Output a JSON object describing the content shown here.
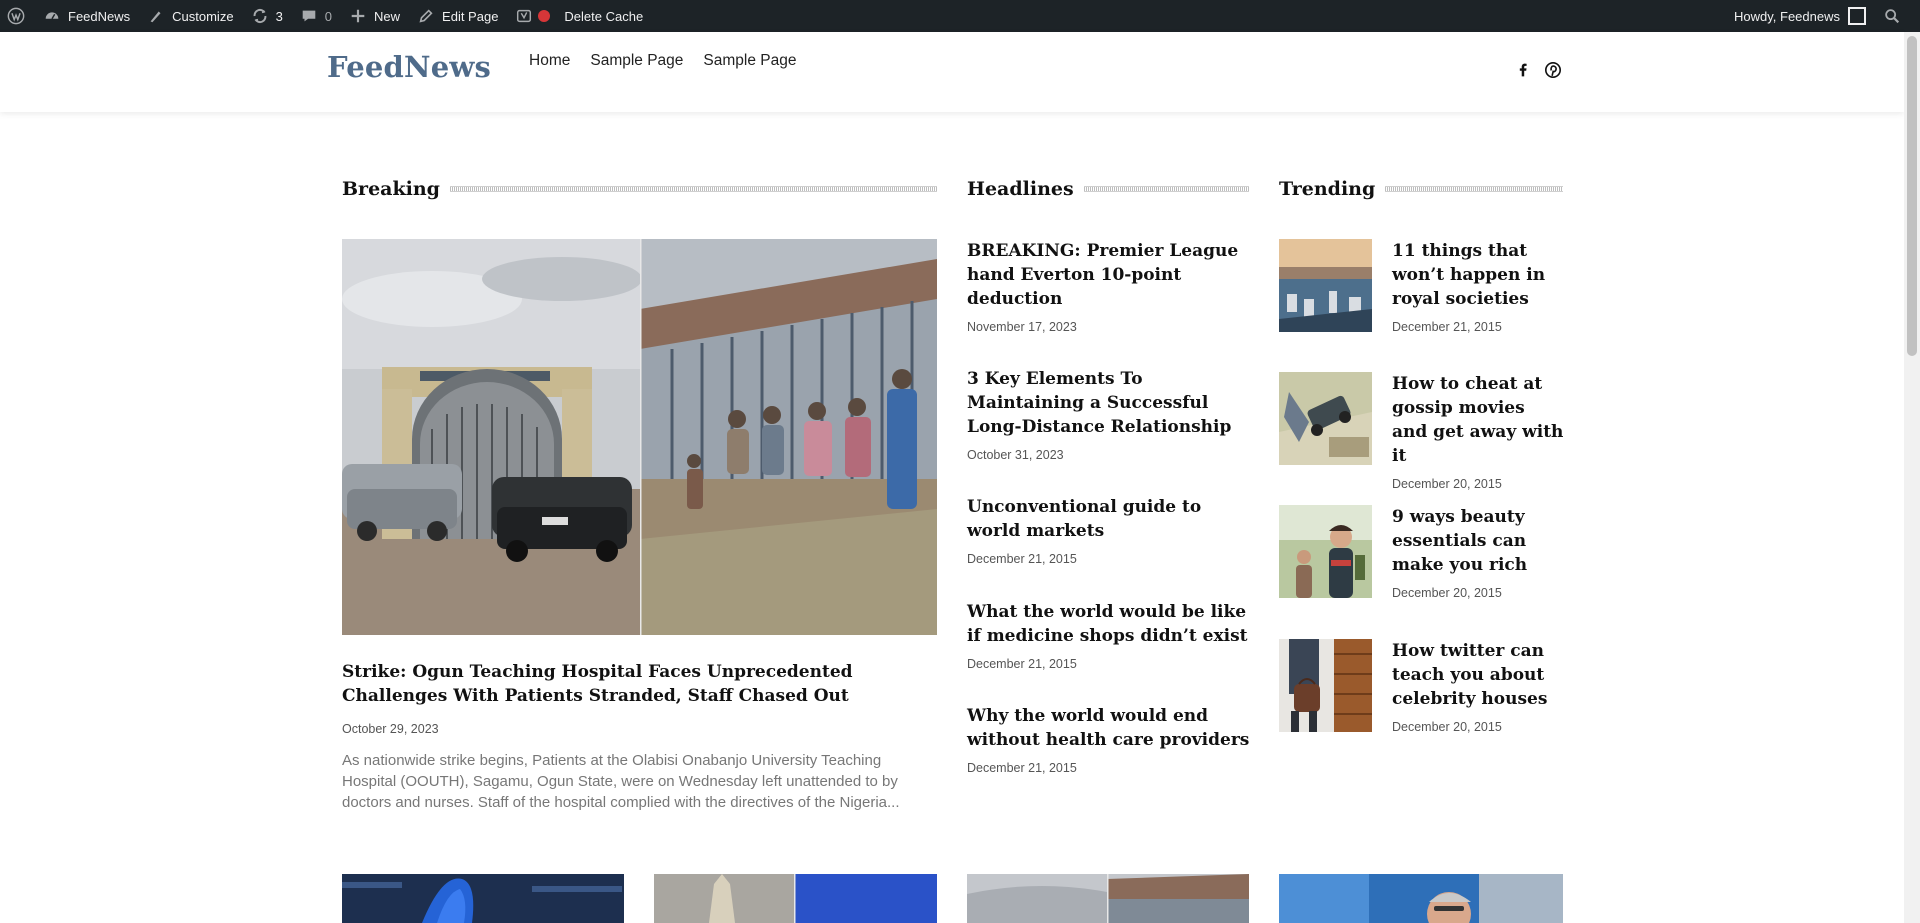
{
  "admin_bar": {
    "site_name": "FeedNews",
    "customize": "Customize",
    "updates_count": "3",
    "comments_count": "0",
    "new_label": "New",
    "edit_page": "Edit Page",
    "delete_cache": "Delete Cache",
    "howdy": "Howdy, Feednews"
  },
  "header": {
    "logo": "FeedNews",
    "nav": [
      "Home",
      "Sample Page",
      "Sample Page"
    ],
    "social": [
      "facebook-icon",
      "pinterest-icon"
    ]
  },
  "breaking": {
    "heading": "Breaking",
    "title": "Strike: Ogun Teaching Hospital Faces Unprecedented Challenges With Patients Stranded, Staff Chased Out",
    "date": "October 29, 2023",
    "excerpt": "As nationwide strike begins, Patients at the Olabisi Onabanjo University Teaching Hospital (OOUTH), Sagamu, Ogun State, were on Wednesday left unattended to by doctors and nurses. Staff of the hospital complied with the directives of the Nigeria..."
  },
  "headlines": {
    "heading": "Headlines",
    "items": [
      {
        "title": "BREAKING: Premier League hand Everton 10-point deduction",
        "date": "November 17, 2023"
      },
      {
        "title": "3 Key Elements To Maintaining a Successful Long-Distance Relationship",
        "date": "October 31, 2023"
      },
      {
        "title": "Unconventional guide to world markets",
        "date": "December 21, 2015"
      },
      {
        "title": "What the world would be like if medicine shops didn’t exist",
        "date": "December 21, 2015"
      },
      {
        "title": "Why the world would end without health care providers",
        "date": "December 21, 2015"
      }
    ]
  },
  "trending": {
    "heading": "Trending",
    "items": [
      {
        "title": "11 things that won’t happen in royal societies",
        "date": "December 21, 2015"
      },
      {
        "title": "How to cheat at gossip movies and get away with it",
        "date": "December 20, 2015"
      },
      {
        "title": "9 ways beauty essentials can make you rich",
        "date": "December 20, 2015"
      },
      {
        "title": "How twitter can teach you about celebrity houses",
        "date": "December 20, 2015"
      }
    ]
  },
  "colors": {
    "admin_bar_bg": "#1d2327",
    "logo": "#4f6b8a",
    "cache_dot": "#d63638"
  }
}
